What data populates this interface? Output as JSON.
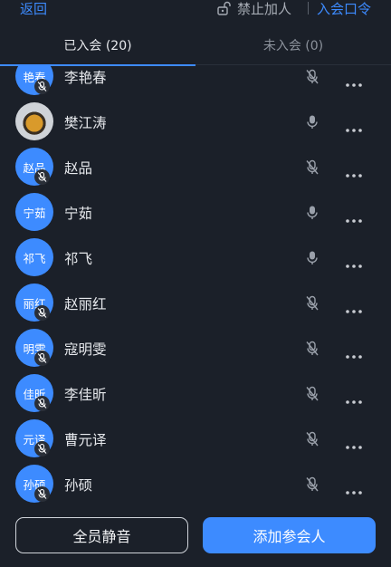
{
  "topbar": {
    "back_label": "返回",
    "lock_icon": "lock-icon",
    "lock_label": "禁止加人",
    "password_label": "入会口令"
  },
  "tabs": {
    "joined": "已入会 (20)",
    "not_joined": "未入会 (0)"
  },
  "participants": [
    {
      "avatar_text": "艳春",
      "name": "李艳春",
      "mic": "mic-muted"
    },
    {
      "avatar_text": "",
      "name": "樊江涛",
      "mic": "mic-on",
      "avatar_kind": "photo"
    },
    {
      "avatar_text": "赵品",
      "name": "赵品",
      "mic": "mic-muted"
    },
    {
      "avatar_text": "宁茹",
      "name": "宁茹",
      "mic": "mic-on"
    },
    {
      "avatar_text": "祁飞",
      "name": "祁飞",
      "mic": "mic-on"
    },
    {
      "avatar_text": "丽红",
      "name": "赵丽红",
      "mic": "mic-muted"
    },
    {
      "avatar_text": "明雯",
      "name": "寇明雯",
      "mic": "mic-muted"
    },
    {
      "avatar_text": "佳昕",
      "name": "李佳昕",
      "mic": "mic-muted"
    },
    {
      "avatar_text": "元译",
      "name": "曹元译",
      "mic": "mic-muted"
    },
    {
      "avatar_text": "孙硕",
      "name": "孙硕",
      "mic": "mic-muted"
    }
  ],
  "footer": {
    "mute_all": "全员静音",
    "add_participant": "添加参会人"
  },
  "colors": {
    "accent": "#3d8bff",
    "background": "#1b2029"
  }
}
